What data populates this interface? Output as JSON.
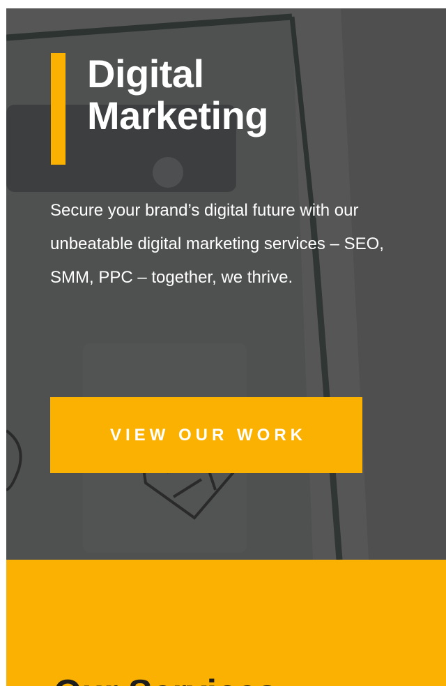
{
  "hero": {
    "title_line1": "Digital",
    "title_line2": "Marketing",
    "description": "Secure your brand’s digital future with our unbeatable digital marketing services – SEO, SMM, PPC – together, we thrive.",
    "cta_label": "VIEW OUR WORK"
  },
  "services": {
    "heading": "Our Services"
  },
  "colors": {
    "accent": "#fbb102",
    "hero_overlay": "#535353",
    "text_light": "#ffffff",
    "heading_dark": "#1e1e1e"
  }
}
